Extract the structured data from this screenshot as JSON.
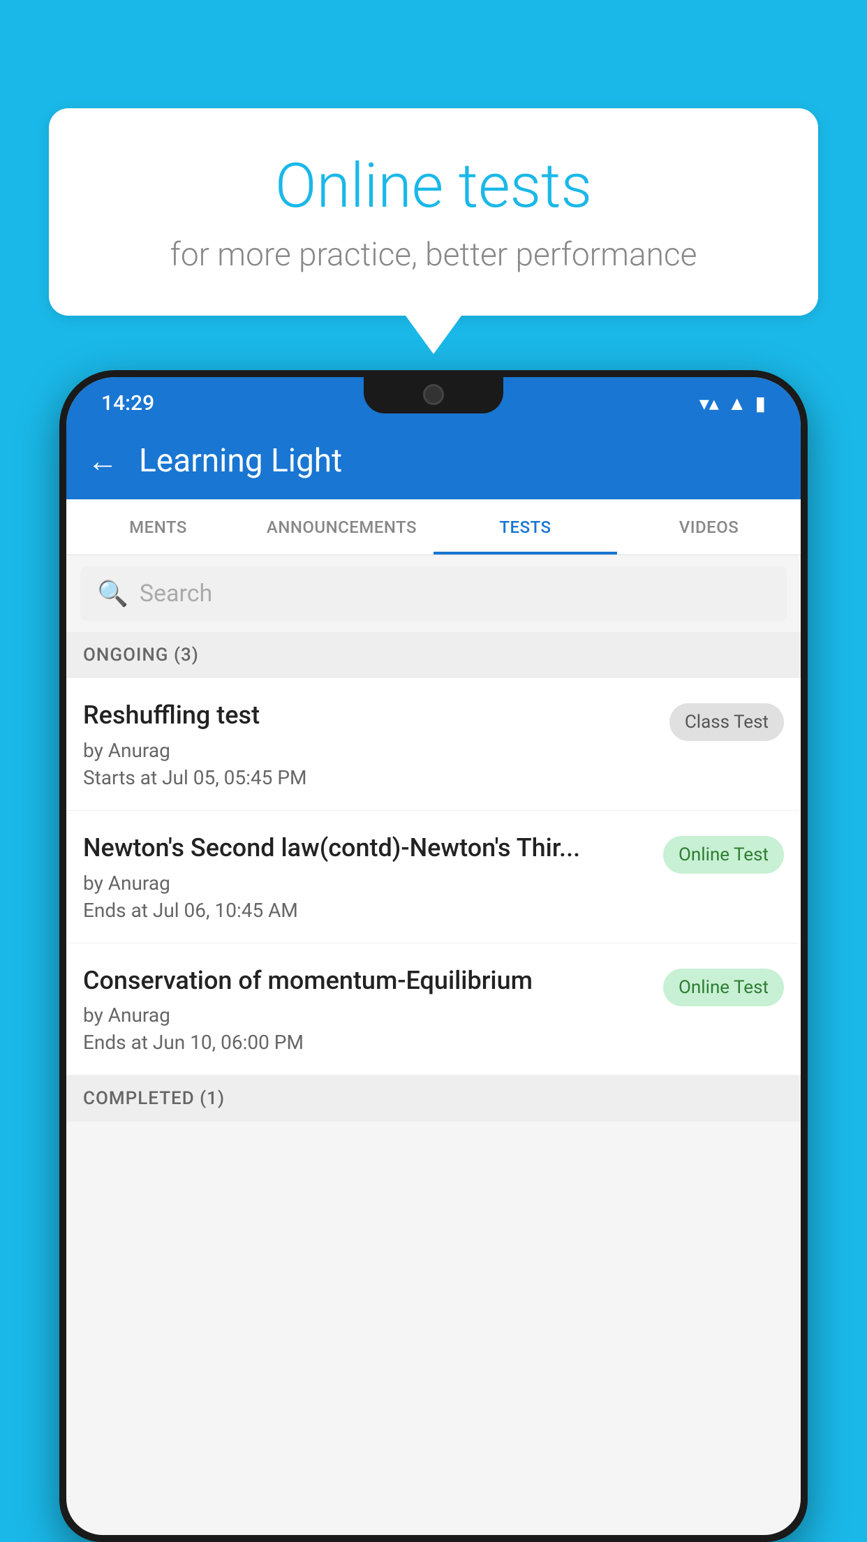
{
  "background_color": "#1ab8e8",
  "speech_bubble": {
    "title": "Online tests",
    "subtitle": "for more practice, better performance"
  },
  "phone": {
    "status_bar": {
      "time": "14:29",
      "icons": [
        "wifi",
        "signal",
        "battery"
      ]
    },
    "app_bar": {
      "title": "Learning Light",
      "back_label": "←"
    },
    "tabs": [
      {
        "label": "MENTS",
        "active": false
      },
      {
        "label": "ANNOUNCEMENTS",
        "active": false
      },
      {
        "label": "TESTS",
        "active": true
      },
      {
        "label": "VIDEOS",
        "active": false
      }
    ],
    "search": {
      "placeholder": "Search"
    },
    "sections": [
      {
        "header": "ONGOING (3)",
        "items": [
          {
            "name": "Reshuffling test",
            "author": "by Anurag",
            "date": "Starts at  Jul 05, 05:45 PM",
            "badge": "Class Test",
            "badge_type": "class"
          },
          {
            "name": "Newton's Second law(contd)-Newton's Thir...",
            "author": "by Anurag",
            "date": "Ends at  Jul 06, 10:45 AM",
            "badge": "Online Test",
            "badge_type": "online"
          },
          {
            "name": "Conservation of momentum-Equilibrium",
            "author": "by Anurag",
            "date": "Ends at  Jun 10, 06:00 PM",
            "badge": "Online Test",
            "badge_type": "online"
          }
        ]
      }
    ],
    "completed_header": "COMPLETED (1)"
  }
}
